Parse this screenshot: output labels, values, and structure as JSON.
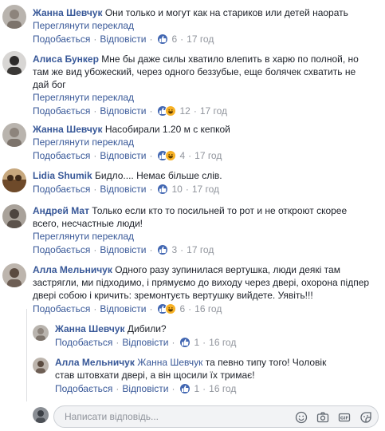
{
  "labels": {
    "like": "Подобається",
    "reply": "Відповісти",
    "see_translation": "Переглянути переклад",
    "sep": "·"
  },
  "comments": [
    {
      "author": "Жанна Шевчук",
      "text": "Они только и могут как на стариков или детей наорать",
      "reactions": "6",
      "time": "17 год"
    },
    {
      "author": "Алиса Бункер",
      "text": "Мне бы даже силы хватило влепить в харю по полной, но там же вид убожеский, через одного беззубые, еще болячек схватить не дай бог",
      "reactions": "12",
      "time": "17 год"
    },
    {
      "author": "Жанна Шевчук",
      "text": "Насобирали 1.20 м с кепкой",
      "reactions": "4",
      "time": "17 год"
    },
    {
      "author": "Lidia Shumik",
      "text": "Бидло.... Немає більше слів.",
      "reactions": "10",
      "time": "17 год"
    },
    {
      "author": "Андрей Мат",
      "text": "Только если кто то посильней то рот и не откроют скорее всего, несчастные люди!",
      "reactions": "3",
      "time": "17 год"
    },
    {
      "author": "Алла Мельничук",
      "text": "Одного разу зупинилася вертушка, люди деякі там застрягли, ми підходимо, і прямуємо до виходу через двері, охорона підпер двері собою і кричить: зремонтуєть вертушку вийдете. Уявіть!!!",
      "reactions": "6",
      "time": "16 год"
    }
  ],
  "replies": [
    {
      "author": "Жанна Шевчук",
      "text": "Дибили?",
      "reactions": "1",
      "time": "16 год"
    },
    {
      "author": "Алла Мельничук",
      "mention": "Жанна Шевчук",
      "text": "та певно типу того! Чоловік став штовхати двері, а він щосили їх тримає!",
      "reactions": "1",
      "time": "16 год"
    }
  ],
  "composer": {
    "placeholder": "Написати відповідь..."
  },
  "colors": {
    "link": "#385898",
    "meta": "#90949c",
    "like": "#4267b2",
    "haha": "#f7b125"
  }
}
